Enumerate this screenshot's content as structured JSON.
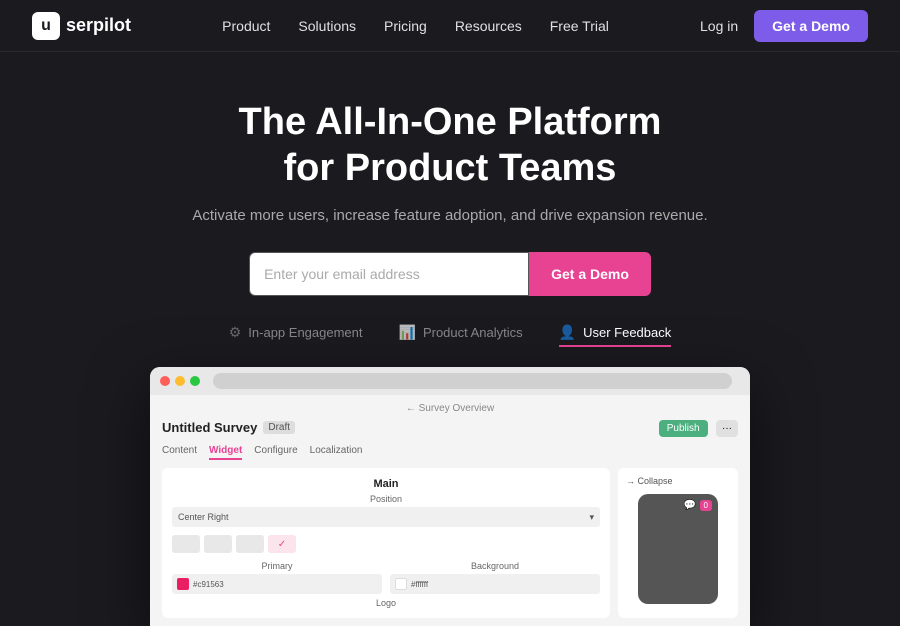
{
  "logo": {
    "box_letter": "u",
    "name": "serpilot",
    "full": "userpilot"
  },
  "nav": {
    "links": [
      {
        "label": "Product",
        "id": "product"
      },
      {
        "label": "Solutions",
        "id": "solutions"
      },
      {
        "label": "Pricing",
        "id": "pricing"
      },
      {
        "label": "Resources",
        "id": "resources"
      },
      {
        "label": "Free Trial",
        "id": "free-trial"
      }
    ],
    "login_label": "Log in",
    "demo_label": "Get a Demo"
  },
  "hero": {
    "title_line1": "The All-In-One Platform",
    "title_line2": "for Product Teams",
    "subtitle": "Activate more users, increase feature adoption, and drive expansion revenue.",
    "email_placeholder": "Enter your email address",
    "cta_label": "Get a Demo"
  },
  "feature_tabs": [
    {
      "label": "In-app Engagement",
      "icon": "⚙",
      "active": false
    },
    {
      "label": "Product Analytics",
      "icon": "📊",
      "active": false
    },
    {
      "label": "User Feedback",
      "icon": "👤",
      "active": true
    }
  ],
  "screenshot": {
    "breadcrumb": "← Survey Overview",
    "survey_title": "Untitled Survey",
    "draft_badge": "Draft",
    "tabs": [
      "Content",
      "Widget",
      "Configure",
      "Localization"
    ],
    "active_tab": "Widget",
    "publish_label": "Publish",
    "section_title": "Main",
    "position_label": "Position",
    "position_value": "Center Right",
    "primary_label": "Primary",
    "primary_color": "#E91E63",
    "primary_hex": "#c91563",
    "background_label": "Background",
    "background_hex": "#ffffff",
    "logo_label": "Logo",
    "collapse_label": "→ Collapse"
  },
  "colors": {
    "accent_pink": "#e84393",
    "accent_purple": "#7c5ce8",
    "nav_bg": "#1a1a1f",
    "body_bg": "#1a1a1f"
  }
}
